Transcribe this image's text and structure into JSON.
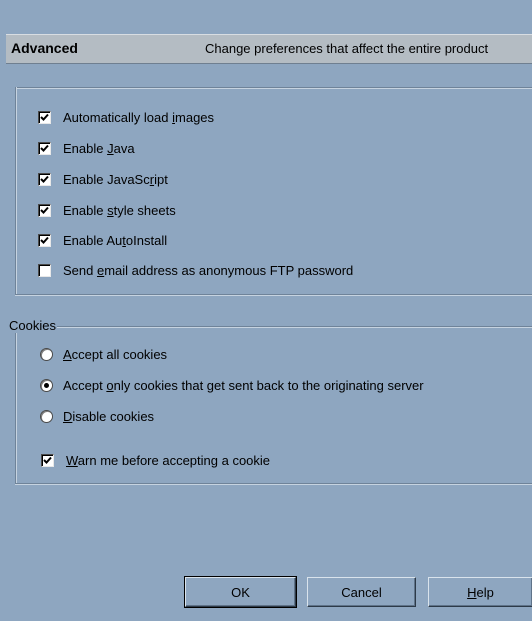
{
  "header": {
    "title": "Advanced",
    "description": "Change preferences that affect the entire product"
  },
  "options": [
    {
      "pre": "Automatically load ",
      "u": "i",
      "post": "mages",
      "checked": true
    },
    {
      "pre": "Enable ",
      "u": "J",
      "post": "ava",
      "checked": true
    },
    {
      "pre": "Enable JavaSc",
      "u": "r",
      "post": "ipt",
      "checked": true
    },
    {
      "pre": "Enable ",
      "u": "s",
      "post": "tyle sheets",
      "checked": true
    },
    {
      "pre": "Enable Au",
      "u": "t",
      "post": "oInstall",
      "checked": true
    },
    {
      "pre": "Send ",
      "u": "e",
      "post": "mail address as anonymous FTP password",
      "checked": false
    }
  ],
  "cookies": {
    "label": "Cookies",
    "options": [
      {
        "pre": "",
        "u": "A",
        "post": "ccept all cookies",
        "selected": false
      },
      {
        "pre": "Accept ",
        "u": "o",
        "post": "nly cookies that get sent back to the originating server",
        "selected": true
      },
      {
        "pre": "",
        "u": "D",
        "post": "isable cookies",
        "selected": false
      }
    ],
    "warn": {
      "pre": "",
      "u": "W",
      "post": "arn me before accepting a cookie",
      "checked": true
    }
  },
  "buttons": {
    "ok": "OK",
    "cancel": "Cancel",
    "help_u": "H",
    "help_rest": "elp"
  }
}
